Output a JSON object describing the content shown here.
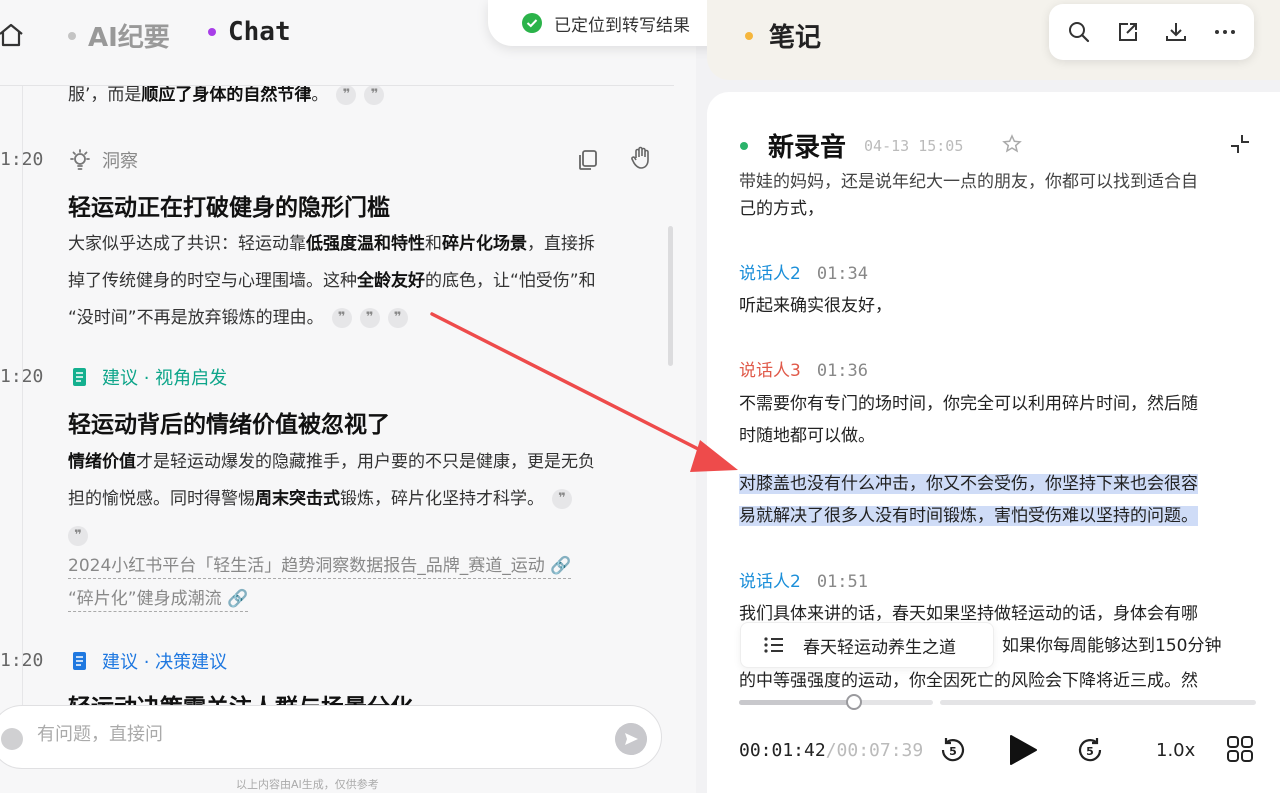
{
  "left": {
    "tabs": [
      {
        "label": "AI纪要"
      },
      {
        "label": "Chat"
      }
    ],
    "prev_card": {
      "text_start": "服’，而是",
      "text_bold": "顺应了身体的自然节律",
      "text_end": "。"
    },
    "cards": [
      {
        "time": "1:20",
        "tag": "洞察",
        "title": "轻运动正在打破健身的隐形门槛",
        "p1": "大家似乎达成了共识：轻运动靠",
        "b1": "低强度温和特性",
        "p2": "和",
        "b2": "碎片化场景",
        "p3": "，直接拆",
        "line2": "掉了传统健身的时空与心理围墙。这种",
        "b3": "全龄友好",
        "p4": "的底色，让“怕受伤”和",
        "line3": "“没时间”不再是放弃锻炼的理由。"
      },
      {
        "time": "1:20",
        "tag": "建议 · 视角启发",
        "title": "轻运动背后的情绪价值被忽视了",
        "b1": "情绪价值",
        "p1": "才是轻运动爆发的隐藏推手，用户要的不只是健康，更是无负",
        "line2a": "担的愉悦感。同时得警惕",
        "b2": "周末突击式",
        "line2b": "锻炼，碎片化坚持才科学。",
        "ref1": "2024小红书平台「轻生活」趋势洞察数据报告_品牌_赛道_运动",
        "ref2": "“碎片化”健身成潮流"
      },
      {
        "time": "1:20",
        "tag": "建议 · 决策建议",
        "title": "轻运动决策需关注人群与场景分化"
      }
    ],
    "quote_glyph": "❞",
    "input_placeholder": "有问题，直接问",
    "footnote": "以上内容由AI生成，仅供参考"
  },
  "toast": {
    "text": "已定位到转写结果"
  },
  "right": {
    "notes_title": "笔记",
    "recording": {
      "title": "新录音",
      "date": "04-13  15:05"
    },
    "transcript": {
      "top_partial": "带娃的妈妈，还是说年纪大一点的朋友，你都可以找到适合自",
      "top_line2": "己的方式，",
      "blocks": [
        {
          "speaker": "说话人2",
          "time": "01:34",
          "text": "听起来确实很友好，"
        },
        {
          "speaker": "说话人3",
          "time": "01:36",
          "text1": "不需要你有专门的场时间，你完全可以利用碎片时间，然后随",
          "text2": "时随地都可以做。"
        },
        {
          "highlight1": "对膝盖也没有什么冲击，你又不会受伤，你坚持下来也会很容",
          "highlight2": "易就解决了很多人没有时间锻炼，害怕受伤难以坚持的问题。"
        },
        {
          "speaker": "说话人2",
          "time": "01:51",
          "text1": "我们具体来讲的话，春天如果坚持做轻运动的话，身体会有哪",
          "text2": "如果你每周能够达到150分钟",
          "text3": "的中等强强度的运动，你全因死亡的风险会下降将近三成。然"
        }
      ]
    },
    "outline_chip": "春天轻运动养生之道",
    "player": {
      "current": "00:01:42",
      "total": "/00:07:39",
      "speed": "1.0x",
      "progress": 0.22
    }
  }
}
